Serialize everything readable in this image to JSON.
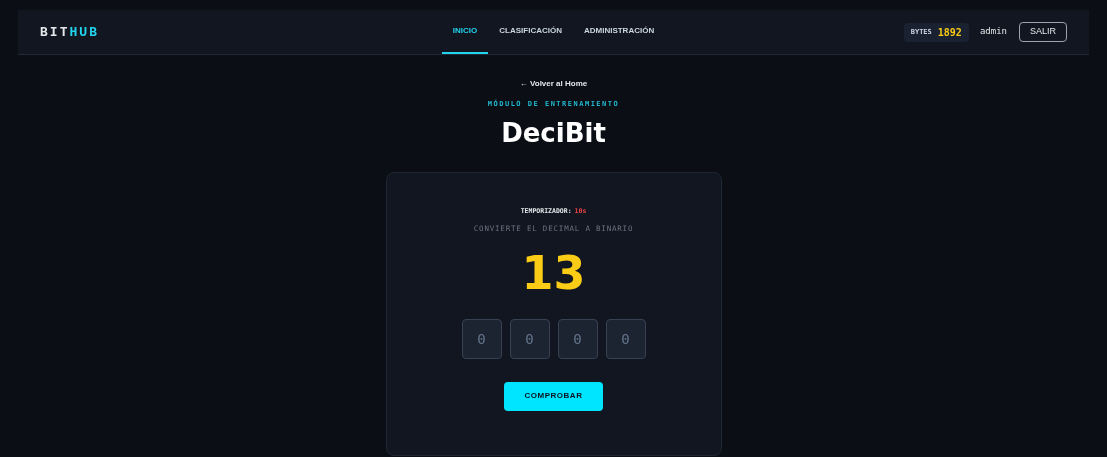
{
  "header": {
    "logo": {
      "part_1": "BIT",
      "part_2": "HUB"
    },
    "nav": [
      {
        "label": "INICIO",
        "selected": true
      },
      {
        "label": "CLASIFICACIÓN",
        "selected": false
      },
      {
        "label": "ADMINISTRACIÓN",
        "selected": false
      }
    ],
    "bytes": {
      "label": "BYTES",
      "value": "1892"
    },
    "user": "admin",
    "logout": "SALIR"
  },
  "back_link": "← Volver al Home",
  "eyebrow": "MÓDULO DE ENTRENAMIENTO",
  "title": "DeciBit",
  "card": {
    "timer": {
      "label": "TEMPORIZADOR:",
      "value": "10s"
    },
    "instruction": "CONVIERTE EL DECIMAL A BINARIO",
    "number": "13",
    "bits": [
      {
        "placeholder": "0"
      },
      {
        "placeholder": "0"
      },
      {
        "placeholder": "0"
      },
      {
        "placeholder": "0"
      }
    ],
    "button": "COMPROBAR"
  }
}
